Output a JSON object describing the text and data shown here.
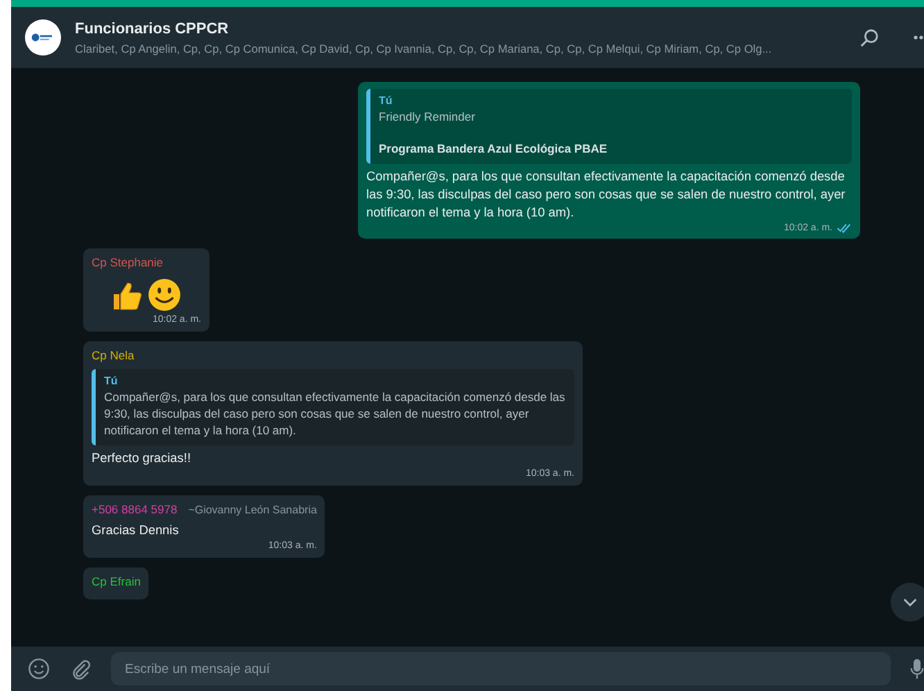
{
  "header": {
    "title": "Funcionarios CPPCR",
    "subtitle": "Claribet, Cp Angelin, Cp, Cp, Cp Comunica, Cp David, Cp, Cp Ivannia, Cp, Cp, Cp Mariana, Cp, Cp, Cp Melqui, Cp Miriam, Cp, Cp Olg..."
  },
  "messages": [
    {
      "kind": "outgoing",
      "quote": {
        "author": "Tú",
        "lines": [
          {
            "text": "Friendly Reminder",
            "bold": false
          },
          {
            "text": "Programa Bandera Azul Ecológica PBAE",
            "bold": true
          }
        ]
      },
      "text": "Compañer@s, para los que consultan efectivamente la capacitación comenzó desde las 9:30, las disculpas del caso pero son cosas que se salen de nuestro control, ayer notificaron el tema y la hora (10 am).",
      "time": "10:02 a. m.",
      "read": true
    },
    {
      "kind": "emoji",
      "sender": "Cp Stephanie",
      "color": "#d9534f",
      "time": "10:02 a. m."
    },
    {
      "kind": "incoming",
      "sender": "Cp Nela",
      "color": "#d4b106",
      "quote": {
        "author": "Tú",
        "lines": [
          {
            "text": "Compañer@s, para los que consultan efectivamente la capacitación comenzó desde las 9:30, las disculpas del caso pero son cosas que se salen de nuestro control, ayer notificaron el tema y la hora (10 am).",
            "bold": false
          }
        ]
      },
      "text": "Perfecto gracias!!",
      "time": "10:03 a. m."
    },
    {
      "kind": "incoming",
      "sender": "+506 8864 5978",
      "alias": "~Giovanny León Sanabria",
      "color": "#d63fa8",
      "text": "Gracias Dennis",
      "time": "10:03 a. m."
    },
    {
      "kind": "incoming",
      "sender": "Cp Efrain",
      "color": "#25c13c"
    }
  ],
  "composer": {
    "placeholder": "Escribe un mensaje aquí"
  }
}
